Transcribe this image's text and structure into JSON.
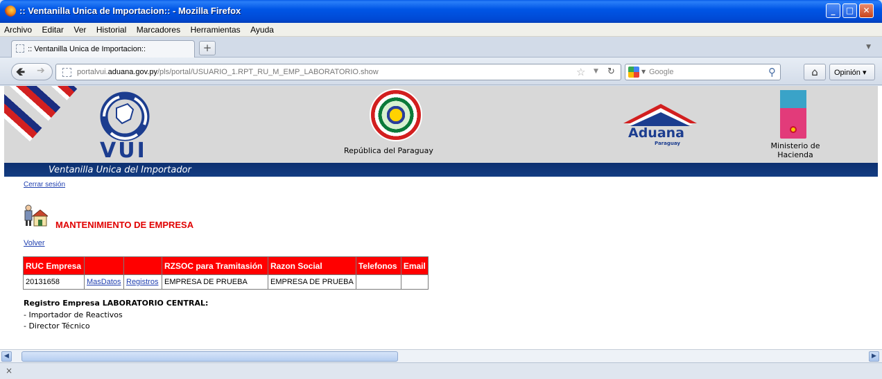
{
  "window": {
    "title": ":: Ventanilla Unica de Importacion:: - Mozilla Firefox",
    "controls": [
      "_",
      "□",
      "✕"
    ]
  },
  "menubar": {
    "items": [
      "Archivo",
      "Editar",
      "Ver",
      "Historial",
      "Marcadores",
      "Herramientas",
      "Ayuda"
    ]
  },
  "tabs": [
    {
      "label": ":: Ventanilla Unica de Importacion::",
      "active": true
    }
  ],
  "navbar": {
    "url_prefix": "portalvui.",
    "url_domain": "aduana.gov.py",
    "url_path": "/pls/portal/USUARIO_1.RPT_RU_M_EMP_LABORATORIO.show",
    "search_placeholder": "Google",
    "opinion_label": "Opinión"
  },
  "banner": {
    "vui_text": "VUI",
    "republica": "República del Paraguay",
    "aduana": "Aduana",
    "aduana_sub": "Paraguay",
    "hacienda_line1": "Ministerio de",
    "hacienda_line2": "Hacienda",
    "subtitle": "Ventanilla Unica del Importador"
  },
  "page": {
    "logout_link": "Cerrar sesión",
    "title": "MANTENIMIENTO DE EMPRESA",
    "back_link": "Volver",
    "table": {
      "headers": [
        "RUC Empresa",
        "",
        "",
        "RZSOC para Tramitasión",
        "Razon Social",
        "Telefonos",
        "Email"
      ],
      "rows": [
        {
          "ruc": "20131658",
          "link1": "MasDatos",
          "link2": "Registros",
          "rzsoc": "EMPRESA DE PRUEBA",
          "razon_social": "EMPRESA DE PRUEBA",
          "telefonos": "",
          "email": ""
        }
      ]
    },
    "registro_title": "Registro Empresa LABORATORIO CENTRAL:",
    "registro_items": [
      "- Importador de Reactivos",
      "- Director Técnico"
    ]
  },
  "statusbar": {
    "close_glyph": "×"
  },
  "colors": {
    "header_red": "#ff0000",
    "title_red": "#e00000",
    "link_blue": "#1f3fb0",
    "banner_navy": "#0c2f70"
  }
}
